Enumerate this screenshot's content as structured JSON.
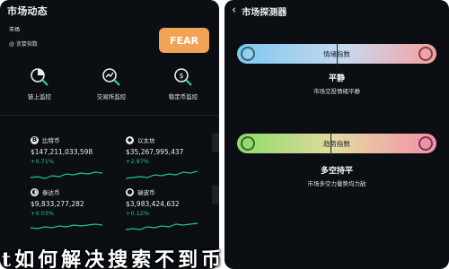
{
  "left": {
    "title": "市场动态",
    "market_label": "市场",
    "market_sub": "@ 贪婪指数",
    "fear_badge": "FEAR",
    "cards": [
      {
        "label": "链上监控",
        "icon": "pie-search-icon"
      },
      {
        "label": "交易所监控",
        "icon": "chart-search-icon"
      },
      {
        "label": "稳定币监控",
        "icon": "coin-search-icon"
      }
    ],
    "coins": [
      {
        "symbol": "B",
        "name": "比特币",
        "price": "$147,211,033,598",
        "change": "+0.71%"
      },
      {
        "symbol": "◆",
        "name": "以太坊",
        "price": "$35,267,995,437",
        "change": "+2.97%"
      },
      {
        "symbol": "◐",
        "name": "泰达币",
        "price": "$9,833,277,282",
        "change": "+0.03%"
      },
      {
        "symbol": "●",
        "name": "瑞波币",
        "price": "$3,983,424,632",
        "change": "+0.12%"
      }
    ]
  },
  "right": {
    "title": "市场探测器",
    "gauges": [
      {
        "label": "情绪指数",
        "level": "平静",
        "desc": "市场交投情绪平静",
        "marker": 0.5,
        "color_start": "#7ec8f0",
        "color_end": "#f8a0a0"
      },
      {
        "label": "趋势指数",
        "level": "多空持平",
        "desc": "市场多空力量势均力敌",
        "marker": 0.47,
        "color_start": "#8fdc6a",
        "color_end": "#f58fa8"
      }
    ]
  },
  "caption": "t如何解决搜索不到币"
}
